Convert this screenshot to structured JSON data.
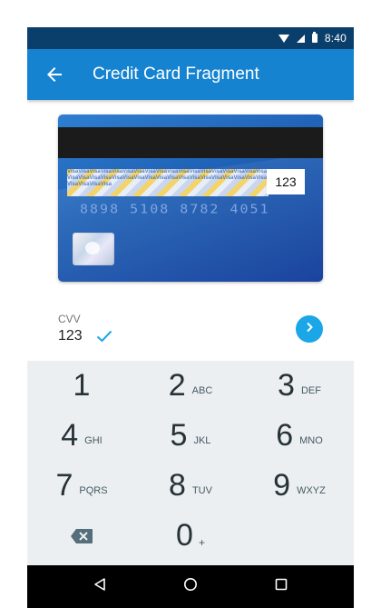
{
  "status_bar": {
    "time": "8:40"
  },
  "app_bar": {
    "title": "Credit Card Fragment"
  },
  "card": {
    "cvv": "123",
    "number_text": "8898 5108 8782 4051",
    "signature_pattern": "VisaVisaVisaVisaVisaVisaVisaVisaVisaVisaVisaVisaVisaVisaVisaVisaVisaVisaVisaVisaVisaVisaVisaVisaVisaVisaVisaVisaVisaVisaVisaVisaVisaVisaVisaVisaVisaVisaVisaVisa"
  },
  "cvv_field": {
    "label": "CVV",
    "value": "123"
  },
  "keypad": {
    "keys": [
      {
        "digit": "1",
        "letters": ""
      },
      {
        "digit": "2",
        "letters": "ABC"
      },
      {
        "digit": "3",
        "letters": "DEF"
      },
      {
        "digit": "4",
        "letters": "GHI"
      },
      {
        "digit": "5",
        "letters": "JKL"
      },
      {
        "digit": "6",
        "letters": "MNO"
      },
      {
        "digit": "7",
        "letters": "PQRS"
      },
      {
        "digit": "8",
        "letters": "TUV"
      },
      {
        "digit": "9",
        "letters": "WXYZ"
      },
      {
        "digit": "0",
        "letters": "+"
      }
    ]
  },
  "colors": {
    "status_bar": "#0b3f6b",
    "app_bar": "#1583d0",
    "accent": "#1ba6e8",
    "keypad_bg": "#eceff1"
  },
  "icons": {
    "back": "arrow-left-icon",
    "check": "check-icon",
    "next": "chevron-right-icon",
    "backspace": "backspace-icon",
    "nav_back": "triangle-back-icon",
    "nav_home": "circle-home-icon",
    "nav_recents": "square-recents-icon"
  }
}
